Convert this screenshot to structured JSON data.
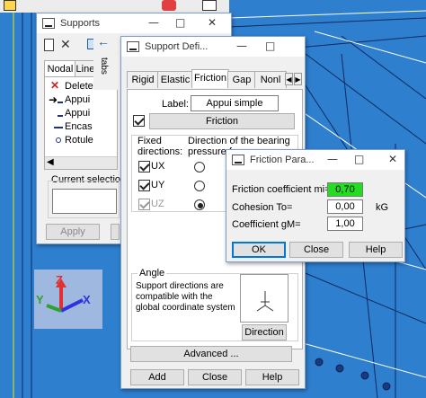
{
  "colors": {
    "background": "#2f7fcf",
    "highlight_field": "#22dd22"
  },
  "supports_window": {
    "title": "Supports",
    "tabs": [
      "Nodal",
      "Linea"
    ],
    "vertical_tab": "tabs",
    "list_items": [
      "Delete",
      "Appui",
      "Appui",
      "Encas",
      "Rotule"
    ],
    "current_selection_label": "Current selection",
    "apply_label": "Apply"
  },
  "support_def_window": {
    "title": "Support Defi...",
    "tabs": [
      "Rigid",
      "Elastic",
      "Friction",
      "Gap",
      "Nonl"
    ],
    "label_caption": "Label:",
    "label_value": "Appui simple",
    "type_button": "Friction",
    "fixed_directions_header": "Fixed directions:",
    "bearing_header": "Direction of the bearing pressure force",
    "directions": [
      {
        "name": "UX",
        "checked": true,
        "enabled": true,
        "radio": false
      },
      {
        "name": "UY",
        "checked": true,
        "enabled": true,
        "radio": false
      },
      {
        "name": "UZ",
        "checked": true,
        "enabled": false,
        "radio": true
      }
    ],
    "angle_group": "Angle",
    "angle_note": "Support directions are compatible with the global coordinate system",
    "direction_button": "Direction",
    "advanced_button": "Advanced ...",
    "add_button": "Add",
    "close_button": "Close",
    "help_button": "Help"
  },
  "friction_window": {
    "title": "Friction Para...",
    "rows": [
      {
        "label": "Friction coefficient mi=",
        "value": "0,70",
        "unit": ""
      },
      {
        "label": "Cohesion To=",
        "value": "0,00",
        "unit": "kG"
      },
      {
        "label": "Coefficient gM=",
        "value": "1,00",
        "unit": ""
      }
    ],
    "ok_button": "OK",
    "close_button": "Close",
    "help_button": "Help"
  },
  "axis_gizmo": {
    "x": "X",
    "y": "Y",
    "z": "Z"
  }
}
